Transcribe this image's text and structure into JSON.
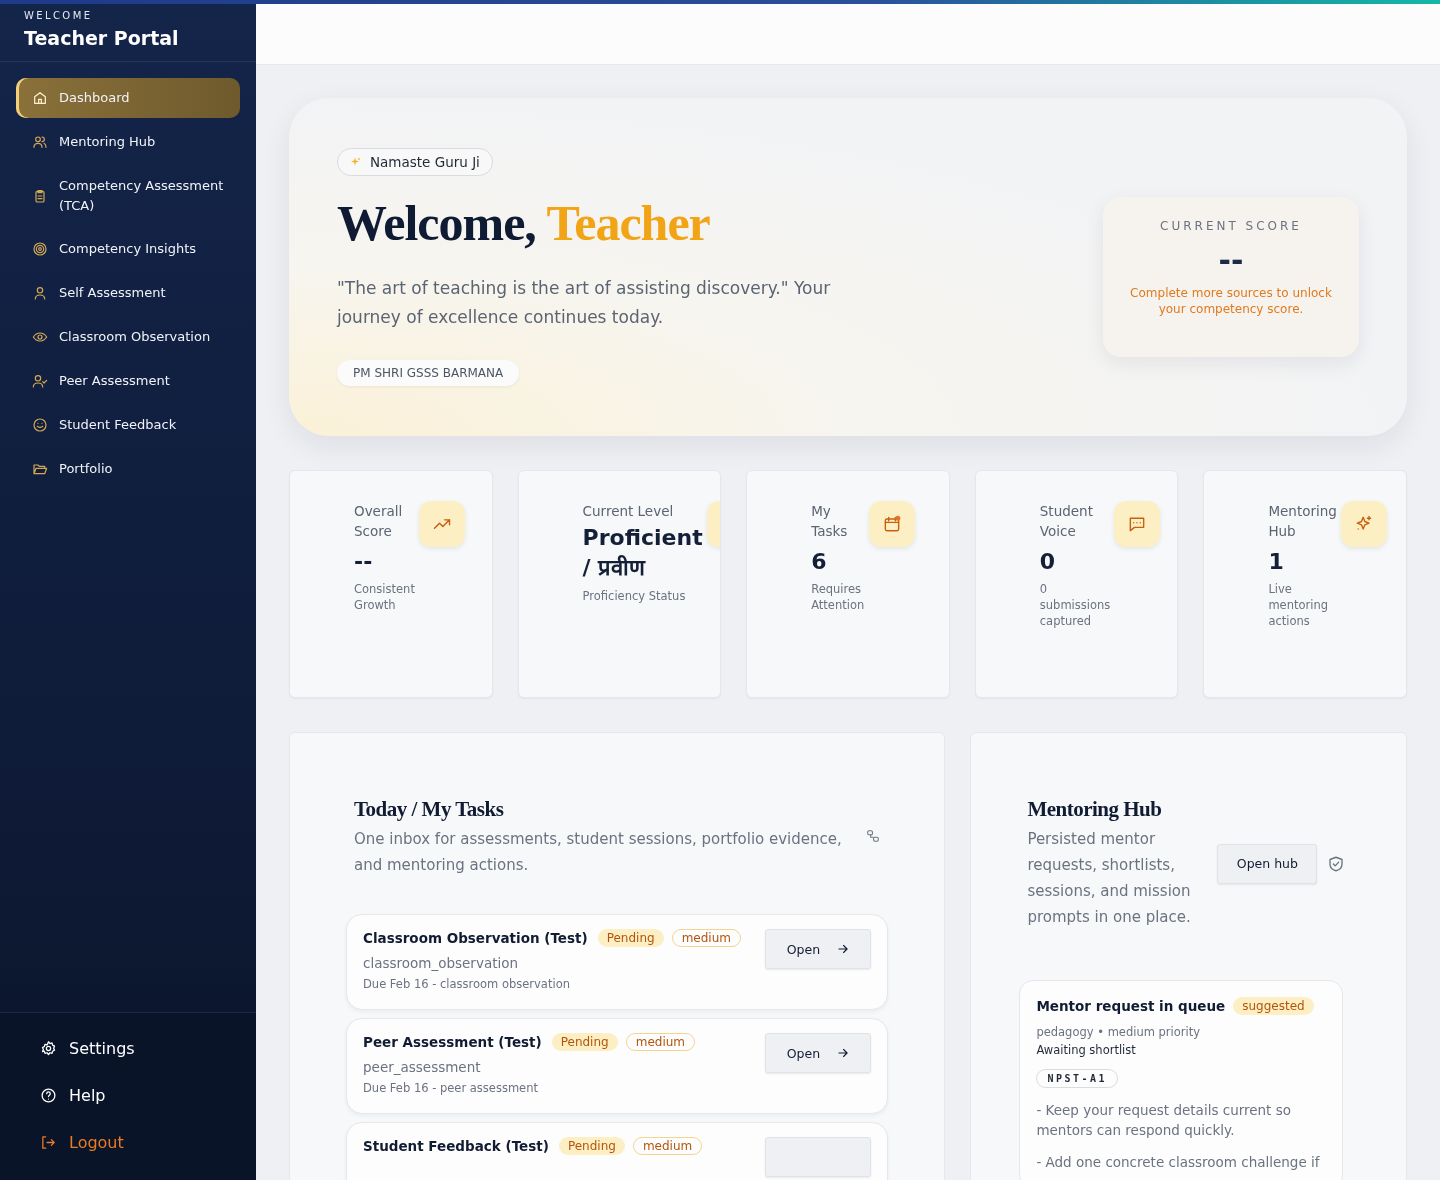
{
  "sidebar": {
    "eyebrow": "WELCOME",
    "title": "Teacher Portal",
    "items": [
      {
        "label": "Dashboard",
        "selected": true
      },
      {
        "label": "Mentoring Hub",
        "selected": false
      },
      {
        "label": "Competency Assessment (TCA)",
        "selected": false
      },
      {
        "label": "Competency Insights",
        "selected": false
      },
      {
        "label": "Self Assessment",
        "selected": false
      },
      {
        "label": "Classroom Observation",
        "selected": false
      },
      {
        "label": "Peer Assessment",
        "selected": false
      },
      {
        "label": "Student Feedback",
        "selected": false
      },
      {
        "label": "Portfolio",
        "selected": false
      }
    ],
    "footer": [
      {
        "label": "Settings",
        "kind": "settings"
      },
      {
        "label": "Help",
        "kind": "help"
      },
      {
        "label": "Logout",
        "kind": "logout"
      }
    ]
  },
  "hero": {
    "badge": "Namaste Guru Ji",
    "greeting": "Welcome,",
    "name": "Teacher",
    "quote": "\"The art of teaching is the art of assisting discovery.\" Your journey of excellence continues today.",
    "school": "PM SHRI GSSS BARMANA",
    "score": {
      "label": "CURRENT SCORE",
      "value": "--",
      "hint": "Complete more sources to unlock your competency score."
    }
  },
  "stats": [
    {
      "label": "Overall Score",
      "value": "--",
      "note": "Consistent Growth",
      "kind": "number"
    },
    {
      "label": "Current Level",
      "value": "Proficient / प्रवीण",
      "note": "Proficiency Status",
      "kind": "level"
    },
    {
      "label": "My Tasks",
      "value": "6",
      "note": "Requires Attention",
      "kind": "number"
    },
    {
      "label": "Student Voice",
      "value": "0",
      "note": "0 submissions captured",
      "kind": "number"
    },
    {
      "label": "Mentoring Hub",
      "value": "1",
      "note": "Live mentoring actions",
      "kind": "number"
    }
  ],
  "tasks": {
    "title": "Today / My Tasks",
    "subtitle": "One inbox for assessments, student sessions, portfolio evidence, and mentoring actions.",
    "items": [
      {
        "title": "Classroom Observation (Test)",
        "status": "Pending",
        "priority": "medium",
        "type": "classroom_observation",
        "due": "Due Feb 16 - classroom observation",
        "action": "Open"
      },
      {
        "title": "Peer Assessment (Test)",
        "status": "Pending",
        "priority": "medium",
        "type": "peer_assessment",
        "due": "Due Feb 16 - peer assessment",
        "action": "Open"
      },
      {
        "title": "Student Feedback (Test)",
        "status": "Pending",
        "priority": "medium"
      }
    ]
  },
  "mentoring": {
    "title": "Mentoring Hub",
    "description": "Persisted mentor requests, shortlists, sessions, and mission prompts in one place.",
    "action": "Open hub",
    "request": {
      "title": "Mentor request in queue",
      "status": "suggested",
      "meta": "pedagogy • medium priority",
      "state": "Awaiting shortlist",
      "tag": "NPST-A1",
      "tips": [
        "- Keep your request details current so mentors can respond quickly.",
        "- Add one concrete classroom challenge if"
      ]
    }
  }
}
